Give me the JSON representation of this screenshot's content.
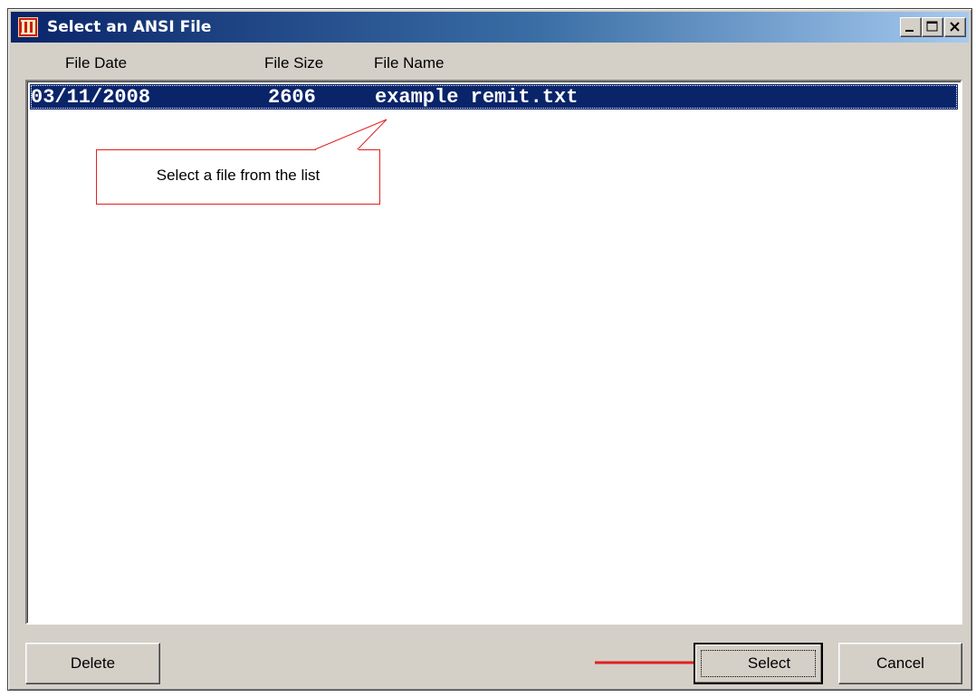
{
  "window": {
    "title": "Select an ANSI File"
  },
  "columns": {
    "date": "File Date",
    "size": "File Size",
    "name": "File Name"
  },
  "files": [
    {
      "date": "03/11/2008",
      "size": "2606",
      "name": "example remit.txt",
      "selected": true
    }
  ],
  "annotation": {
    "text": "Select a file from the list"
  },
  "buttons": {
    "delete": "Delete",
    "select": "Select",
    "cancel": "Cancel"
  },
  "colors": {
    "titlebar_start": "#0a246a",
    "titlebar_end": "#a6caf0",
    "selection": "#0a246a",
    "annotation": "#e02020",
    "window_face": "#d4d0c8"
  },
  "icons": {
    "app": "app-window-icon",
    "minimize": "minimize-icon",
    "maximize": "maximize-icon",
    "close": "close-icon"
  }
}
